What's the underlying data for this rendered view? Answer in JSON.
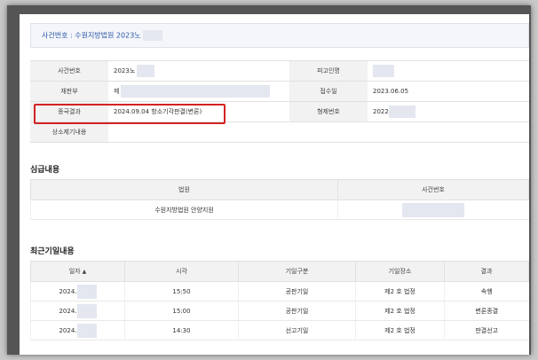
{
  "case_header": {
    "label": "사건번호 : 수원지방법원 2023노"
  },
  "info_rows": [
    {
      "label1": "사건번호",
      "value1": "2023노",
      "label2": "피고인명",
      "value2": ""
    },
    {
      "label1": "재판부",
      "value1": "제",
      "label2": "접수일",
      "value2": "2023.06.05"
    },
    {
      "label1": "종국결과",
      "value1": "2024.09.04 항소기각판결(변론)",
      "label2": "형제번호",
      "value2": "2022"
    },
    {
      "label1": "상소제기내용",
      "value1": "",
      "label2": "",
      "value2": ""
    }
  ],
  "lower_court": {
    "title": "심급내용",
    "headers": [
      "법원",
      "사건번호"
    ],
    "rows": [
      {
        "court": "수원지방법원 안양지원",
        "case_no": ""
      }
    ]
  },
  "recent_hearings": {
    "title": "최근기일내용",
    "headers": [
      "일자",
      "시각",
      "기일구분",
      "기일장소",
      "결과"
    ],
    "rows": [
      {
        "date": "2024.",
        "time": "15:50",
        "type": "공판기일",
        "place": "제2 호 법정",
        "result": "속행"
      },
      {
        "date": "2024.",
        "time": "15:00",
        "type": "공판기일",
        "place": "제2 호 법정",
        "result": "변론종결"
      },
      {
        "date": "2024.",
        "time": "14:30",
        "type": "선고기일",
        "place": "제2 호 법정",
        "result": "판결선고"
      }
    ]
  },
  "icons": {
    "sort": "sort-ascending-icon"
  },
  "colors": {
    "highlight": "#d32222",
    "header_link": "#2a56a6"
  }
}
